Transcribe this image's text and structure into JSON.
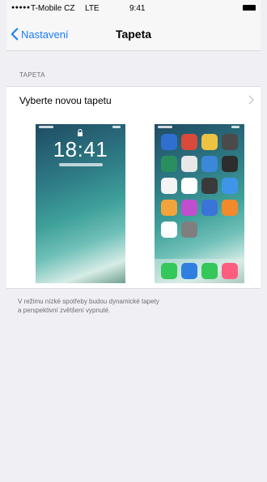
{
  "status_bar": {
    "carrier": "T-Mobile CZ",
    "network": "LTE",
    "time": "9:41"
  },
  "nav": {
    "back_label": "Nastavení",
    "title": "Tapeta"
  },
  "section": {
    "header": "TAPETA",
    "choose_label": "Vyberte novou tapetu"
  },
  "lock_preview": {
    "time": "18:41"
  },
  "home_preview": {
    "app_colors": [
      "#2f6fd0",
      "#d94a3a",
      "#f0c241",
      "#4a4a4a",
      "#2a8f5e",
      "#e8e8e8",
      "#3b88d9",
      "#2d2d2d",
      "#f4f4f4",
      "#ffffff",
      "#3a3a3a",
      "#3f95e8",
      "#f0a43a",
      "#c04fd0",
      "#3a74d8",
      "#f08a2a",
      "#ffffff",
      "#7f7f7f"
    ],
    "dock_colors": [
      "#34c759",
      "#2f7fe0",
      "#34c759",
      "#fd5e7d"
    ]
  },
  "footer": {
    "line1": "V režimu nízké spotřeby budou dynamické tapety",
    "line2": "a perspektivní zvětšení vypnuté."
  },
  "colors": {
    "accent": "#1a7cf5",
    "background": "#efeff4"
  }
}
